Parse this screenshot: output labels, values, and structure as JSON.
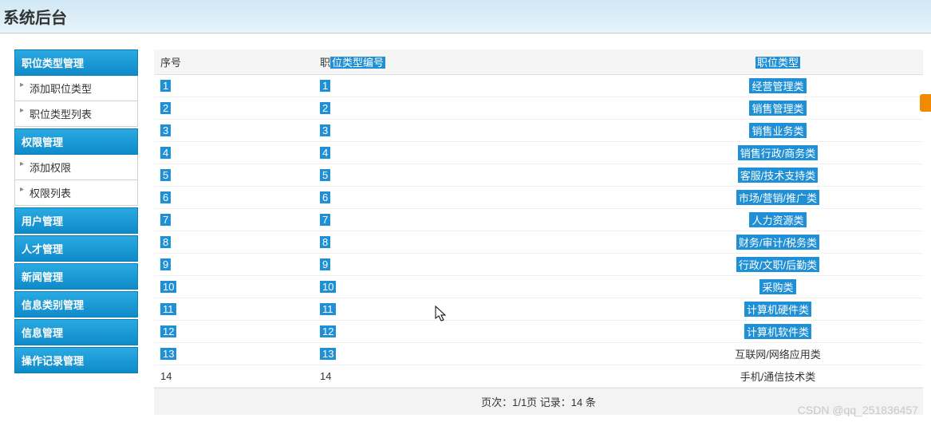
{
  "header": {
    "title": "系统后台"
  },
  "sidebar": {
    "groups": [
      {
        "label": "职位类型管理",
        "items": [
          "添加职位类型",
          "职位类型列表"
        ]
      },
      {
        "label": "权限管理",
        "items": [
          "添加权限",
          "权限列表"
        ]
      },
      {
        "label": "用户管理",
        "items": []
      },
      {
        "label": "人才管理",
        "items": []
      },
      {
        "label": "新闻管理",
        "items": []
      },
      {
        "label": "信息类别管理",
        "items": []
      },
      {
        "label": "信息管理",
        "items": []
      },
      {
        "label": "操作记录管理",
        "items": []
      }
    ]
  },
  "table": {
    "headers": {
      "seq_plain": "序号",
      "code_prefix": "职",
      "code_sel": "位类型编号",
      "type_sel": "职位类型"
    },
    "rows": [
      {
        "seq": "1",
        "code": "1",
        "type": "经营管理类",
        "sel": true
      },
      {
        "seq": "2",
        "code": "2",
        "type": "销售管理类",
        "sel": true
      },
      {
        "seq": "3",
        "code": "3",
        "type": "销售业务类",
        "sel": true
      },
      {
        "seq": "4",
        "code": "4",
        "type": "销售行政/商务类",
        "sel": true
      },
      {
        "seq": "5",
        "code": "5",
        "type": "客服/技术支持类",
        "sel": true
      },
      {
        "seq": "6",
        "code": "6",
        "type": "市场/营销/推广类",
        "sel": true
      },
      {
        "seq": "7",
        "code": "7",
        "type": "人力资源类",
        "sel": true
      },
      {
        "seq": "8",
        "code": "8",
        "type": "财务/审计/税务类",
        "sel": true
      },
      {
        "seq": "9",
        "code": "9",
        "type": "行政/文职/后勤类",
        "sel": true
      },
      {
        "seq": "10",
        "code": "10",
        "type": "采购类",
        "sel": true
      },
      {
        "seq": "11",
        "code": "11",
        "type": "计算机硬件类",
        "sel": true
      },
      {
        "seq": "12",
        "code": "12",
        "type": "计算机软件类",
        "sel": true
      },
      {
        "seq": "13",
        "code": "13",
        "type": "互联网/网络应用类",
        "sel": false,
        "seqsel": true,
        "codesel": true
      },
      {
        "seq": "14",
        "code": "14",
        "type": "手机/通信技术类",
        "sel": false
      }
    ]
  },
  "pager": {
    "text": "页次：1/1页 记录：14 条"
  },
  "watermark": {
    "text": "CSDN @qq_251836457"
  }
}
